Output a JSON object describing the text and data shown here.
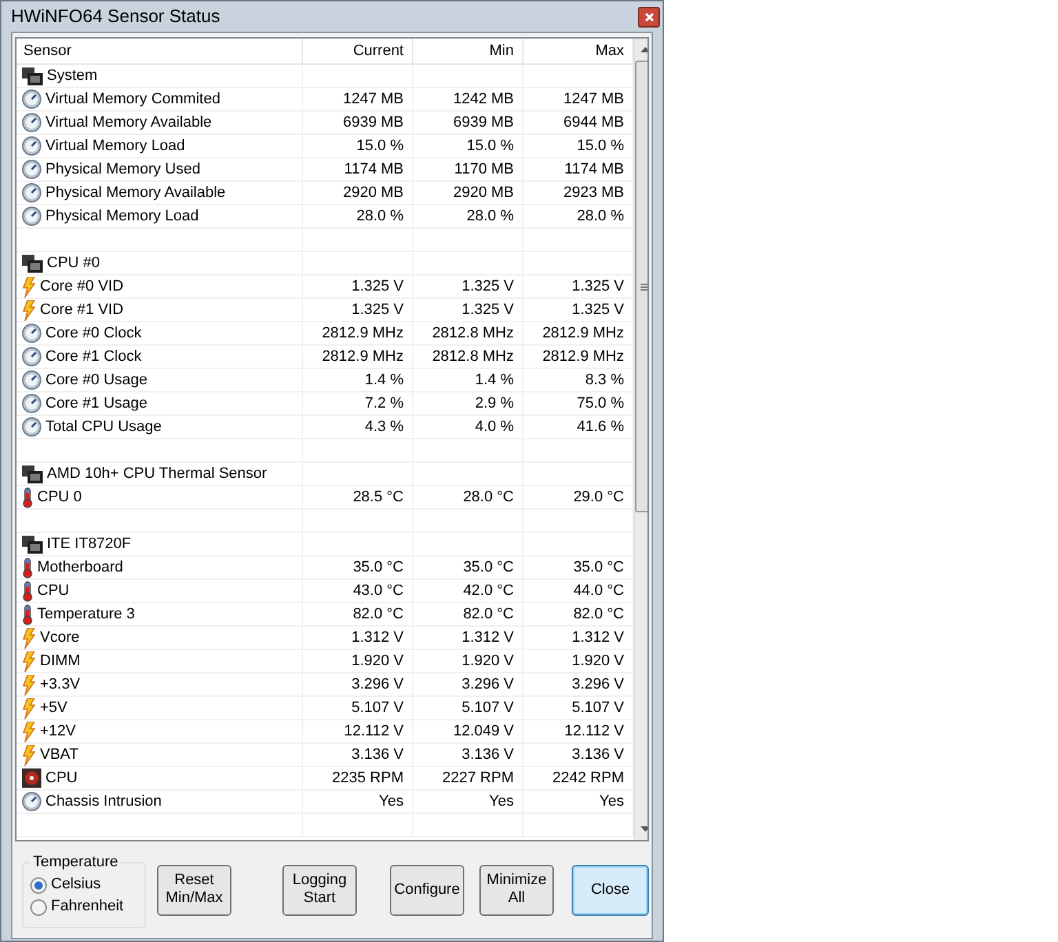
{
  "window": {
    "title": "HWiNFO64 Sensor Status"
  },
  "table": {
    "columns": [
      "Sensor",
      "Current",
      "Min",
      "Max"
    ],
    "rows": [
      {
        "kind": "group",
        "sensor": "System"
      },
      {
        "kind": "gauge",
        "sensor": "Virtual Memory Commited",
        "current": "1247 MB",
        "min": "1242 MB",
        "max": "1247 MB"
      },
      {
        "kind": "gauge",
        "sensor": "Virtual Memory Available",
        "current": "6939 MB",
        "min": "6939 MB",
        "max": "6944 MB"
      },
      {
        "kind": "gauge",
        "sensor": "Virtual Memory Load",
        "current": "15.0 %",
        "min": "15.0 %",
        "max": "15.0 %"
      },
      {
        "kind": "gauge",
        "sensor": "Physical Memory Used",
        "current": "1174 MB",
        "min": "1170 MB",
        "max": "1174 MB"
      },
      {
        "kind": "gauge",
        "sensor": "Physical Memory Available",
        "current": "2920 MB",
        "min": "2920 MB",
        "max": "2923 MB"
      },
      {
        "kind": "gauge",
        "sensor": "Physical Memory Load",
        "current": "28.0 %",
        "min": "28.0 %",
        "max": "28.0 %"
      },
      {
        "kind": "spacer"
      },
      {
        "kind": "group",
        "sensor": "CPU #0"
      },
      {
        "kind": "voltage",
        "sensor": "Core #0 VID",
        "current": "1.325 V",
        "min": "1.325 V",
        "max": "1.325 V"
      },
      {
        "kind": "voltage",
        "sensor": "Core #1 VID",
        "current": "1.325 V",
        "min": "1.325 V",
        "max": "1.325 V"
      },
      {
        "kind": "gauge",
        "sensor": "Core #0 Clock",
        "current": "2812.9 MHz",
        "min": "2812.8 MHz",
        "max": "2812.9 MHz"
      },
      {
        "kind": "gauge",
        "sensor": "Core #1 Clock",
        "current": "2812.9 MHz",
        "min": "2812.8 MHz",
        "max": "2812.9 MHz"
      },
      {
        "kind": "gauge",
        "sensor": "Core #0 Usage",
        "current": "1.4 %",
        "min": "1.4 %",
        "max": "8.3 %"
      },
      {
        "kind": "gauge",
        "sensor": "Core #1 Usage",
        "current": "7.2 %",
        "min": "2.9 %",
        "max": "75.0 %"
      },
      {
        "kind": "gauge",
        "sensor": "Total CPU Usage",
        "current": "4.3 %",
        "min": "4.0 %",
        "max": "41.6 %"
      },
      {
        "kind": "spacer"
      },
      {
        "kind": "group",
        "sensor": "AMD 10h+ CPU Thermal Sensor"
      },
      {
        "kind": "temperature",
        "sensor": "CPU 0",
        "current": "28.5 °C",
        "min": "28.0 °C",
        "max": "29.0 °C"
      },
      {
        "kind": "spacer"
      },
      {
        "kind": "group",
        "sensor": "ITE IT8720F"
      },
      {
        "kind": "temperature",
        "sensor": "Motherboard",
        "current": "35.0 °C",
        "min": "35.0 °C",
        "max": "35.0 °C"
      },
      {
        "kind": "temperature",
        "sensor": "CPU",
        "current": "43.0 °C",
        "min": "42.0 °C",
        "max": "44.0 °C"
      },
      {
        "kind": "temperature",
        "sensor": "Temperature 3",
        "current": "82.0 °C",
        "min": "82.0 °C",
        "max": "82.0 °C"
      },
      {
        "kind": "voltage",
        "sensor": "Vcore",
        "current": "1.312 V",
        "min": "1.312 V",
        "max": "1.312 V"
      },
      {
        "kind": "voltage",
        "sensor": "DIMM",
        "current": "1.920 V",
        "min": "1.920 V",
        "max": "1.920 V"
      },
      {
        "kind": "voltage",
        "sensor": "+3.3V",
        "current": "3.296 V",
        "min": "3.296 V",
        "max": "3.296 V"
      },
      {
        "kind": "voltage",
        "sensor": "+5V",
        "current": "5.107 V",
        "min": "5.107 V",
        "max": "5.107 V"
      },
      {
        "kind": "voltage",
        "sensor": "+12V",
        "current": "12.112 V",
        "min": "12.049 V",
        "max": "12.112 V"
      },
      {
        "kind": "voltage",
        "sensor": "VBAT",
        "current": "3.136 V",
        "min": "3.136 V",
        "max": "3.136 V"
      },
      {
        "kind": "fan",
        "sensor": "CPU",
        "current": "2235 RPM",
        "min": "2227 RPM",
        "max": "2242 RPM"
      },
      {
        "kind": "gauge",
        "sensor": "Chassis Intrusion",
        "current": "Yes",
        "min": "Yes",
        "max": "Yes"
      },
      {
        "kind": "spacer"
      }
    ]
  },
  "temperature": {
    "title": "Temperature",
    "options": [
      {
        "label": "Celsius",
        "selected": true
      },
      {
        "label": "Fahrenheit",
        "selected": false
      }
    ]
  },
  "buttons": [
    {
      "lines": [
        "Reset",
        "Min/Max"
      ],
      "focused": false
    },
    {
      "lines": [
        "Logging",
        "Start"
      ],
      "focused": false
    },
    {
      "lines": [
        "Configure"
      ],
      "focused": false
    },
    {
      "lines": [
        "Minimize",
        "All"
      ],
      "focused": false
    },
    {
      "lines": [
        "Close"
      ],
      "focused": true
    }
  ]
}
